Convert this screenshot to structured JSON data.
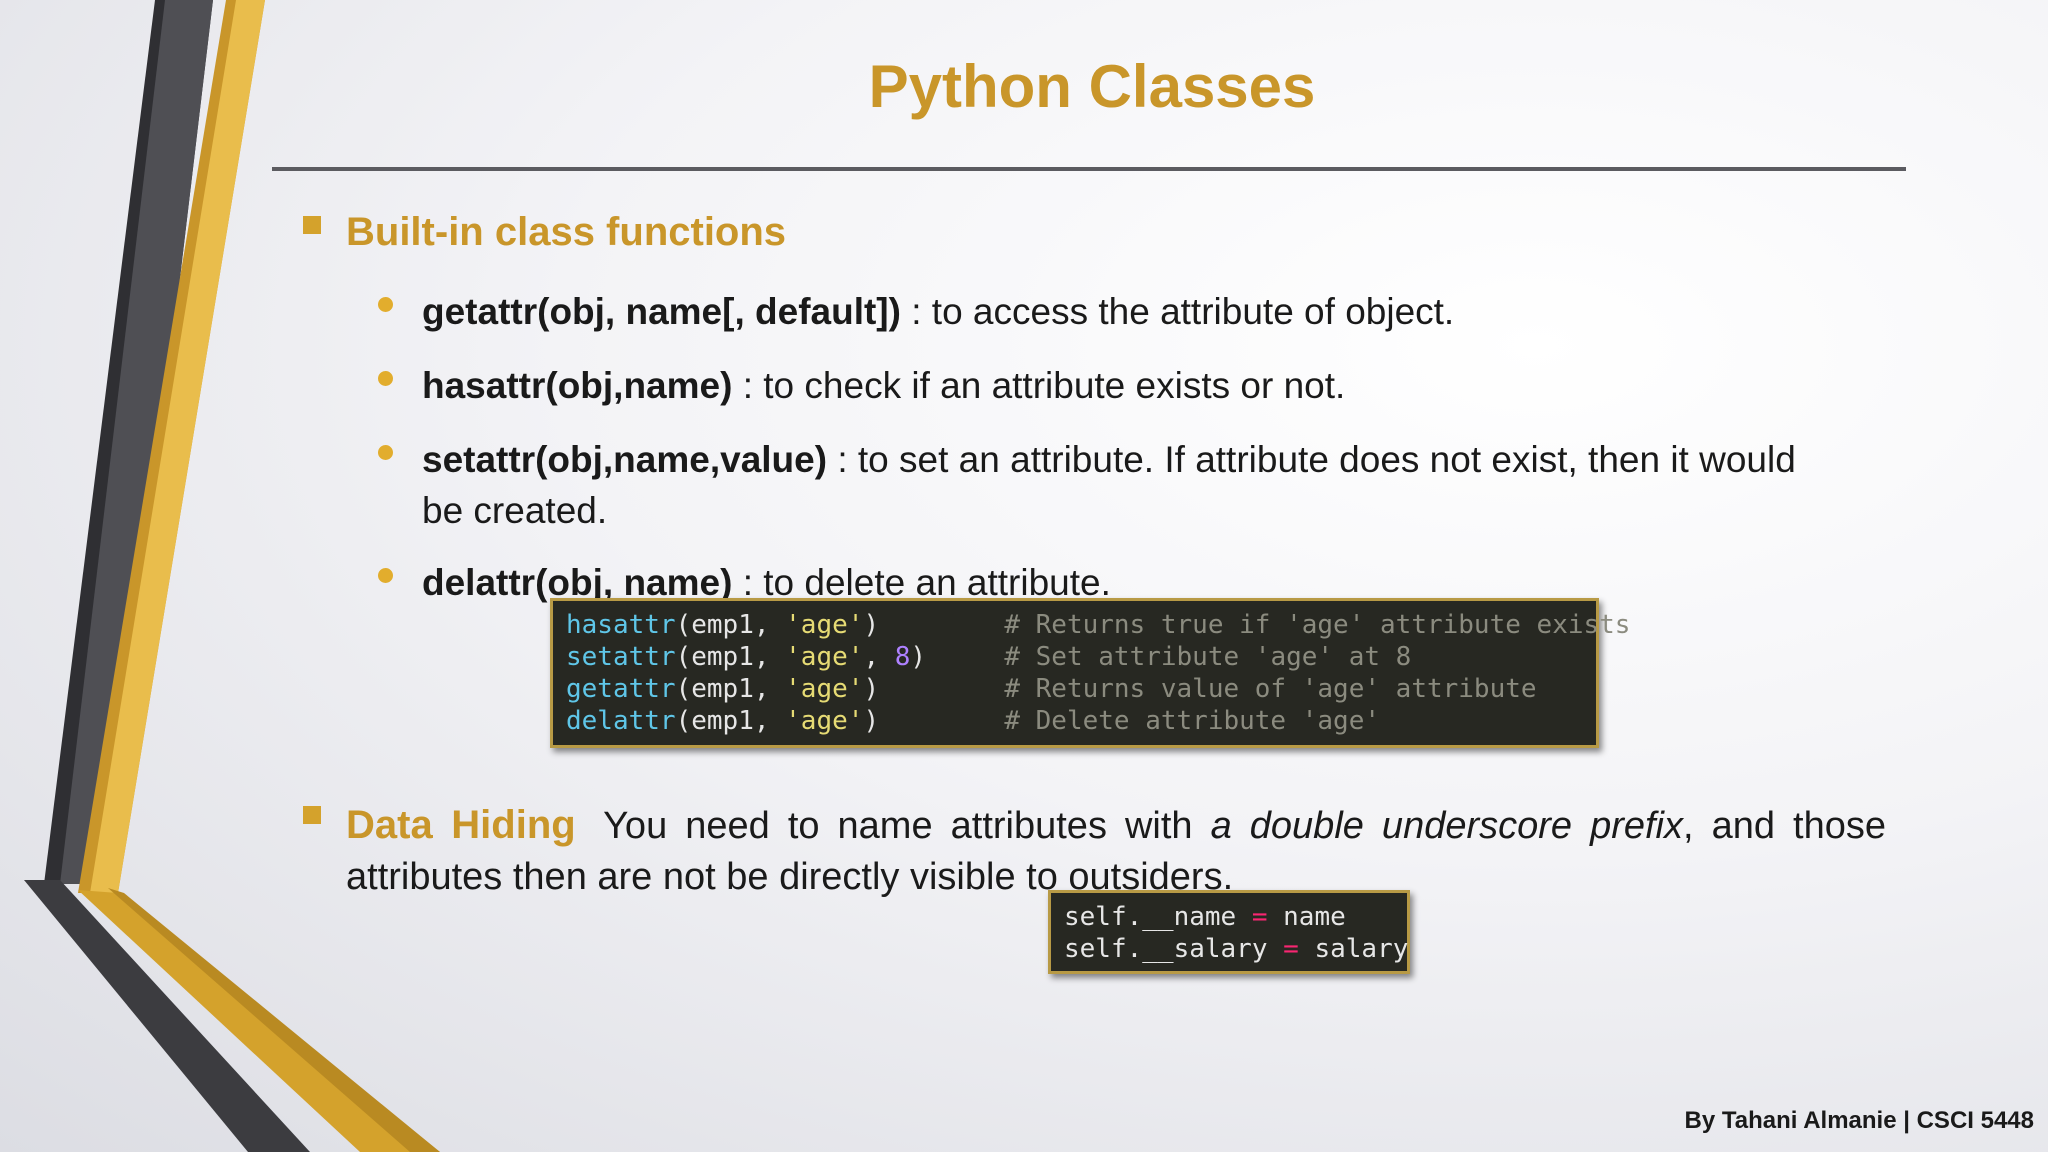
{
  "slide": {
    "title": "Python Classes",
    "section1": {
      "heading": "Built-in class functions",
      "items": [
        {
          "func": "getattr(obj, name[, default])",
          "desc": " : to access the attribute of object."
        },
        {
          "func": "hasattr(obj,name)",
          "desc": " : to check if an attribute exists or not."
        },
        {
          "func": "setattr(obj,name,value)",
          "desc": " : to set an attribute. If attribute does not exist, then it would be created."
        },
        {
          "func": "delattr(obj, name)",
          "desc": " : to delete an attribute."
        }
      ]
    },
    "code1": [
      {
        "fn": "hasattr",
        "args_a": "(emp1, ",
        "str": "'age'",
        "args_b": "",
        "num": "",
        "close": ")",
        "pad": "        ",
        "comment": "# Returns true if 'age' attribute exists"
      },
      {
        "fn": "setattr",
        "args_a": "(emp1, ",
        "str": "'age'",
        "args_b": ", ",
        "num": "8",
        "close": ")",
        "pad": "     ",
        "comment": "# Set attribute 'age' at 8"
      },
      {
        "fn": "getattr",
        "args_a": "(emp1, ",
        "str": "'age'",
        "args_b": "",
        "num": "",
        "close": ")",
        "pad": "        ",
        "comment": "# Returns value of 'age' attribute"
      },
      {
        "fn": "delattr",
        "args_a": "(emp1, ",
        "str": "'age'",
        "args_b": "",
        "num": "",
        "close": ")",
        "pad": "        ",
        "comment": "# Delete attribute 'age'"
      }
    ],
    "section2": {
      "heading": "Data Hiding",
      "text_a": "You need to name attributes with ",
      "text_em": "a double underscore prefix",
      "text_b": ", and those attributes then are not be directly visible to outsiders."
    },
    "code2": [
      {
        "lhs": "self.__name",
        "op": "=",
        "rhs": "name"
      },
      {
        "lhs": "self.__salary",
        "op": "=",
        "rhs": "salary"
      }
    ],
    "footer": "By Tahani Almanie | CSCI 5448",
    "colors": {
      "accent": "#c9962a",
      "bullet": "#e2ad2d",
      "code_bg": "#272822",
      "rule": "#5b5b60"
    }
  }
}
